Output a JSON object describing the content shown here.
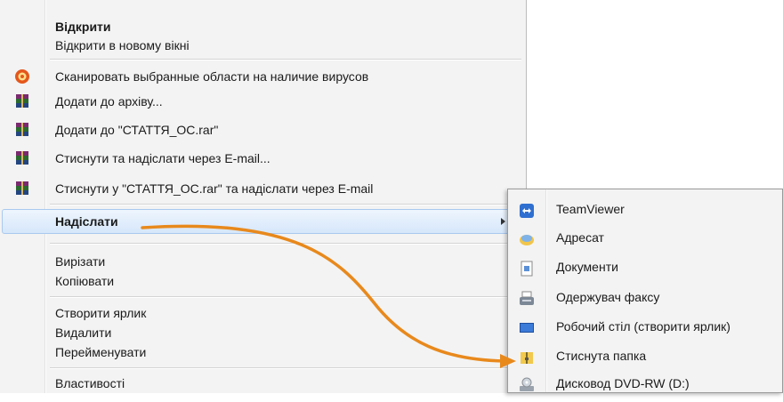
{
  "context_menu": {
    "items": [
      {
        "label": "Відкрити",
        "bold": true,
        "icon": null
      },
      {
        "label": "Відкрити в новому вікні",
        "icon": null
      },
      {
        "label": "Сканировать выбранные области на наличие вирусов",
        "icon": "antivirus-icon"
      },
      {
        "label": "Додати до архіву...",
        "icon": "winrar-icon"
      },
      {
        "label": "Додати до \"СТАТТЯ_ОС.rar\"",
        "icon": "winrar-icon"
      },
      {
        "label": "Стиснути та надіслати через E-mail...",
        "icon": "winrar-icon"
      },
      {
        "label": "Стиснути у \"СТАТТЯ_ОС.rar\" та надіслати через E-mail",
        "icon": "winrar-icon"
      },
      {
        "label": "Надіслати",
        "has_submenu": true,
        "highlighted": true
      },
      {
        "label": "Вирізати"
      },
      {
        "label": "Копіювати"
      },
      {
        "label": "Створити ярлик"
      },
      {
        "label": "Видалити"
      },
      {
        "label": "Перейменувати"
      },
      {
        "label": "Властивості"
      }
    ]
  },
  "send_to_submenu": {
    "items": [
      {
        "label": "TeamViewer",
        "icon": "teamviewer-icon"
      },
      {
        "label": "Адресат",
        "icon": "mail-recipient-icon"
      },
      {
        "label": "Документи",
        "icon": "documents-icon"
      },
      {
        "label": "Одержувач факсу",
        "icon": "fax-icon"
      },
      {
        "label": "Робочий стіл (створити ярлик)",
        "icon": "desktop-icon"
      },
      {
        "label": "Стиснута папка",
        "icon": "zip-folder-icon"
      },
      {
        "label": "Дисковод DVD-RW (D:)",
        "icon": "dvd-drive-icon"
      }
    ]
  },
  "colors": {
    "menu_bg": "#f3f3f3",
    "highlight": "#d6e7fb",
    "annotation_arrow": "#e8891c"
  }
}
